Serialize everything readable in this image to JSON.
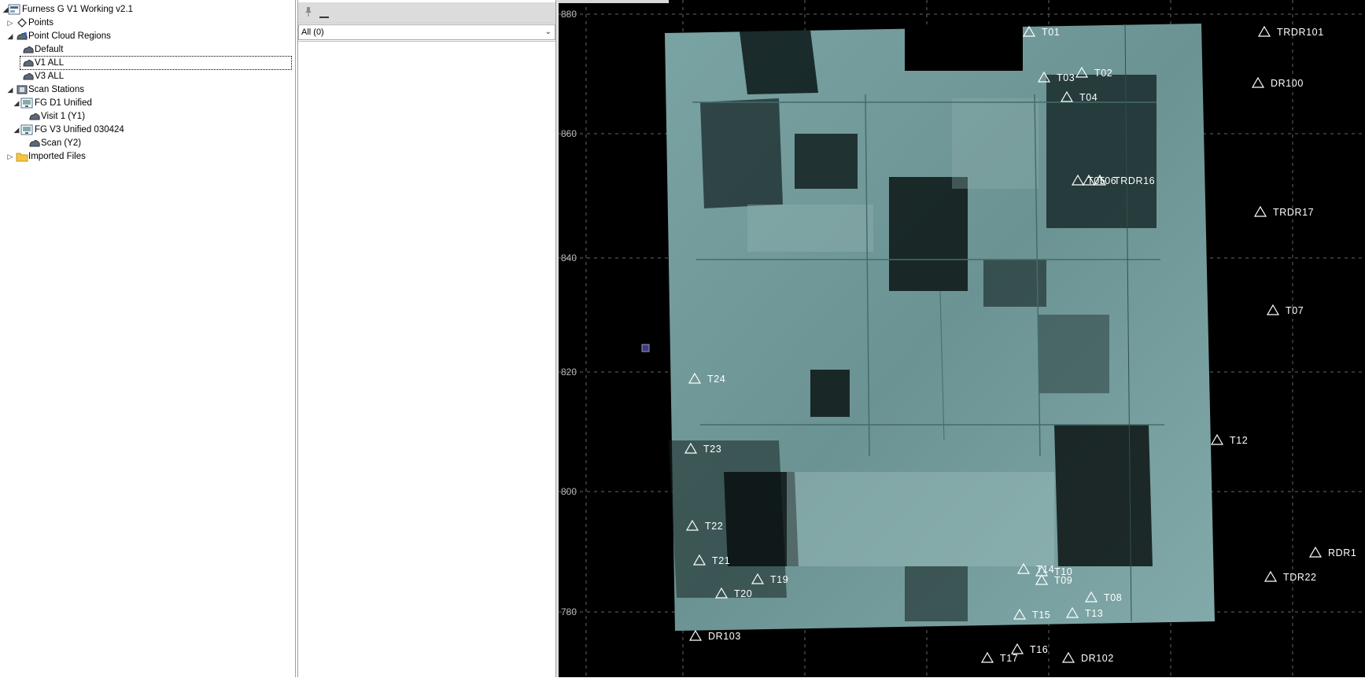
{
  "tree": {
    "items": [
      {
        "label": "Furness G V1 Working v2.1",
        "expander": "◢",
        "icon": "project-icon"
      },
      {
        "label": "Points",
        "expander": "▷",
        "icon": "points-icon"
      },
      {
        "label": "Point Cloud Regions",
        "expander": "◢",
        "icon": "cloud-region-icon"
      },
      {
        "label": "Default",
        "expander": "",
        "icon": "cloud-icon"
      },
      {
        "label": "V1 ALL",
        "expander": "",
        "icon": "cloud-icon"
      },
      {
        "label": "V3 ALL",
        "expander": "",
        "icon": "cloud-icon"
      },
      {
        "label": "Scan Stations",
        "expander": "◢",
        "icon": "scan-stations-icon"
      },
      {
        "label": "FG D1 Unified",
        "expander": "◢",
        "icon": "scan-station-icon"
      },
      {
        "label": "Visit 1 (Y1)",
        "expander": "",
        "icon": "cloud-icon"
      },
      {
        "label": "FG V3 Unified 030424",
        "expander": "◢",
        "icon": "scan-station-icon"
      },
      {
        "label": "Scan (Y2)",
        "expander": "",
        "icon": "cloud-icon"
      },
      {
        "label": "Imported Files",
        "expander": "▷",
        "icon": "folder-icon"
      }
    ]
  },
  "middle": {
    "filter_value": "All (0)"
  },
  "viewport": {
    "grid_labels": [
      "880",
      "860",
      "840",
      "820",
      "800",
      "780"
    ],
    "targets": [
      {
        "label": "T01"
      },
      {
        "label": "TRDR101"
      },
      {
        "label": "T02"
      },
      {
        "label": "T03"
      },
      {
        "label": "DR100"
      },
      {
        "label": "T04"
      },
      {
        "label": "T05"
      },
      {
        "label": "T06"
      },
      {
        "label": "TRDR16"
      },
      {
        "label": "TRDR17"
      },
      {
        "label": "T07"
      },
      {
        "label": "T24"
      },
      {
        "label": "T23"
      },
      {
        "label": "T12"
      },
      {
        "label": "T22"
      },
      {
        "label": "T21"
      },
      {
        "label": "RDR1"
      },
      {
        "label": "T19"
      },
      {
        "label": "T20"
      },
      {
        "label": "T14"
      },
      {
        "label": "T10"
      },
      {
        "label": "T09"
      },
      {
        "label": "TDR22"
      },
      {
        "label": "T08"
      },
      {
        "label": "T15"
      },
      {
        "label": "T13"
      },
      {
        "label": "DR103"
      },
      {
        "label": "T16"
      },
      {
        "label": "T17"
      },
      {
        "label": "DR102"
      }
    ]
  },
  "colors": {
    "viewport_bg": "#000000",
    "cloud": "#6e9898",
    "cloud_light": "#8fb4b4",
    "grid": "#666666",
    "target": "#ffffff"
  }
}
